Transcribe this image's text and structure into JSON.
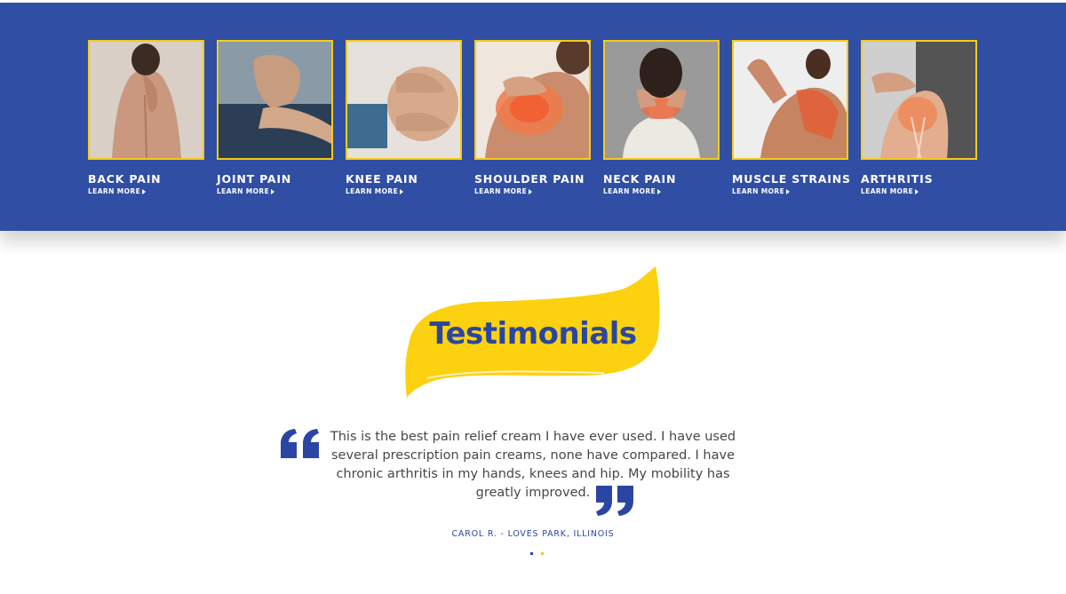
{
  "colors": {
    "band": "#304ea4",
    "accent": "#f5cc16",
    "brand_blue": "#2a46a2",
    "text": "#474747"
  },
  "conditions": [
    {
      "title": "BACK PAIN",
      "link": "LEARN MORE",
      "image_icon": "back-pain-photo"
    },
    {
      "title": "JOINT PAIN",
      "link": "LEARN MORE",
      "image_icon": "joint-pain-photo"
    },
    {
      "title": "KNEE PAIN",
      "link": "LEARN MORE",
      "image_icon": "knee-pain-photo"
    },
    {
      "title": "SHOULDER PAIN",
      "link": "LEARN MORE",
      "image_icon": "shoulder-pain-photo"
    },
    {
      "title": "NECK PAIN",
      "link": "LEARN MORE",
      "image_icon": "neck-pain-photo"
    },
    {
      "title": "MUSCLE STRAINS",
      "link": "LEARN MORE",
      "image_icon": "muscle-strains-photo"
    },
    {
      "title": "ARTHRITIS",
      "link": "LEARN MORE",
      "image_icon": "arthritis-photo"
    }
  ],
  "testimonials": {
    "heading": "Testimonials",
    "quote": "This is the best pain relief cream I have ever used. I have used several prescription pain creams, none have compared. I have chronic arthritis in my hands, knees and hip. My mobility has greatly improved.",
    "author": "CAROL R. - LOVES PARK, ILLINOIS",
    "slider_dots": [
      "#2a46a2",
      "#f5cc16"
    ]
  }
}
